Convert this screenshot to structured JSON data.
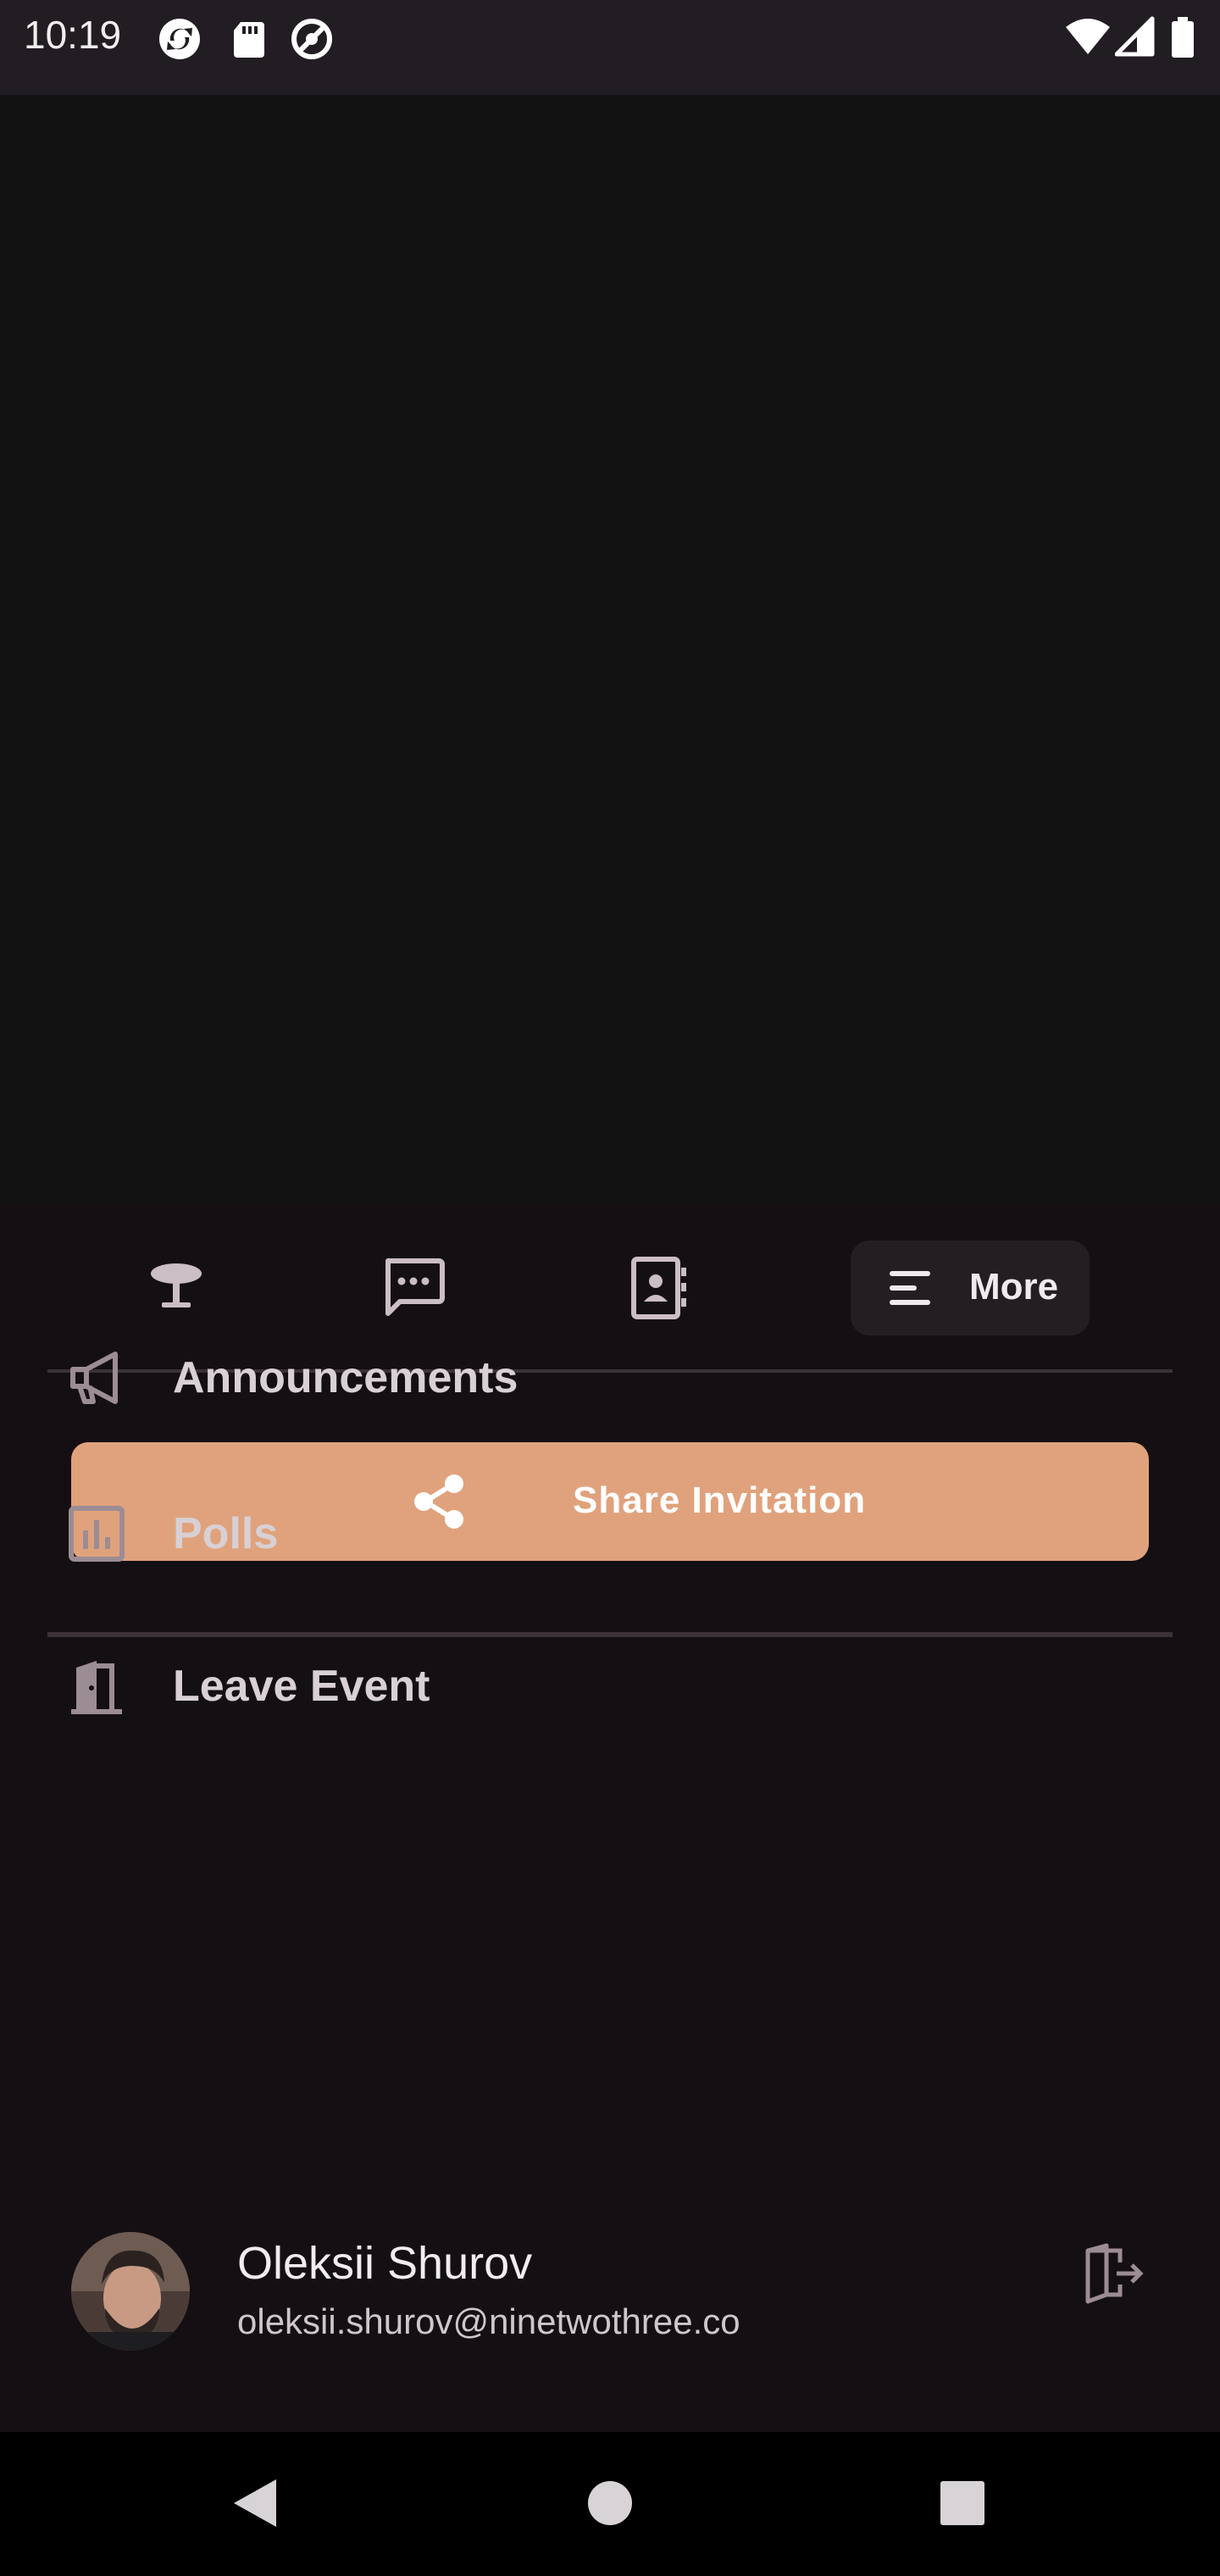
{
  "status_bar": {
    "time": "10:19",
    "left_icons": [
      "sync-icon",
      "sd-card-icon",
      "do-not-disturb-icon"
    ],
    "right_icons": [
      "wifi-icon",
      "cellular-signal-icon",
      "battery-icon"
    ]
  },
  "tabs": {
    "items": [
      {
        "name": "table",
        "icon": "table-icon"
      },
      {
        "name": "messages",
        "icon": "chat-icon"
      },
      {
        "name": "contacts",
        "icon": "contact-book-icon"
      }
    ],
    "more_label": "More",
    "more_icon": "menu-lines-icon"
  },
  "share": {
    "label": "Share Invitation",
    "icon": "share-icon",
    "color": "#E0A27C"
  },
  "menu": {
    "items": [
      {
        "label": "Announcements",
        "icon": "megaphone-icon"
      },
      {
        "label": "Polls",
        "icon": "poll-chart-icon"
      },
      {
        "label": "Leave Event",
        "icon": "door-exit-icon"
      }
    ]
  },
  "profile": {
    "name": "Oleksii Shurov",
    "email": "oleksii.shurov@ninetwothree.co",
    "logout_icon": "logout-icon"
  },
  "nav": {
    "icons": [
      "back-icon",
      "home-icon",
      "recents-icon"
    ]
  }
}
